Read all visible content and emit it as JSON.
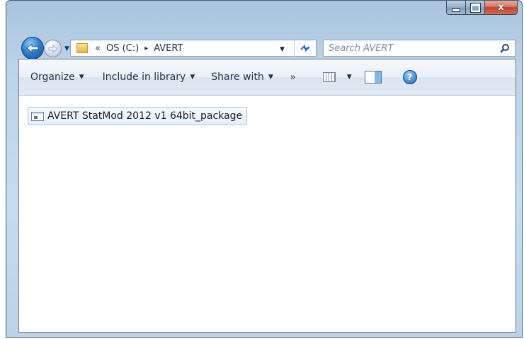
{
  "window": {
    "caption": {
      "minimize_icon": "minimize-icon",
      "maximize_icon": "maximize-icon",
      "close_label": "x"
    }
  },
  "navigation": {
    "address": {
      "overflow_chevron": "«",
      "crumbs": [
        "OS (C:)",
        "AVERT"
      ],
      "separator": "▸"
    },
    "refresh_icon": "refresh-icon",
    "search": {
      "placeholder": "Search AVERT"
    }
  },
  "toolbar": {
    "organize": "Organize",
    "include_in_library": "Include in library",
    "share_with": "Share with",
    "more": "»",
    "caret": "▼",
    "views_icon": "views-icon",
    "preview_pane_icon": "preview-pane-icon",
    "help_label": "?"
  },
  "files": [
    {
      "name": "AVERT StatMod 2012 v1 64bit_package",
      "icon": "application-icon"
    }
  ],
  "colors": {
    "window_frame": "#bcd3e9",
    "close_button": "#c2432a",
    "selection_border": "#aac8ea"
  }
}
